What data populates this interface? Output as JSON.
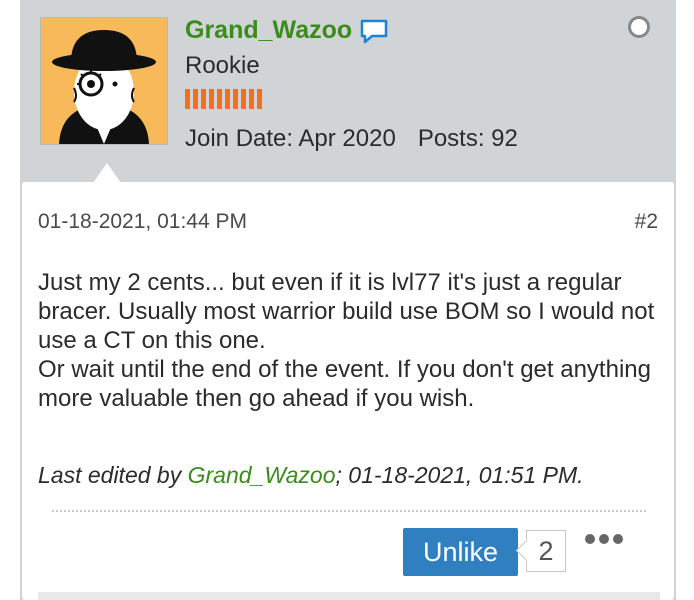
{
  "user": {
    "username": "Grand_Wazoo",
    "title": "Rookie",
    "join_date": "Join Date: Apr 2020",
    "posts": "Posts: 92",
    "reputation_segments": 10,
    "status": "offline"
  },
  "post": {
    "date": "01-18-2021, 01:44 PM",
    "number": "#2",
    "body": [
      "Just my 2 cents... but even if it is lvl77 it's just a regular bracer. Usually most warrior build use BOM so I would not use a CT on this one.",
      "Or wait until the end of the event. If you don't get anything more valuable then go ahead if you wish."
    ],
    "last_edited_prefix": "Last edited by ",
    "last_edited_editor": "Grand_Wazoo",
    "last_edited_suffix": "; 01-18-2021, 01:51 PM."
  },
  "actions": {
    "like_label": "Unlike",
    "like_count": "2",
    "more_icon": "more-dots-icon"
  },
  "colors": {
    "username": "#3a8c1b",
    "reputation": "#f0701c",
    "button": "#2f7fc1",
    "header_bg": "#d1d4d7"
  }
}
